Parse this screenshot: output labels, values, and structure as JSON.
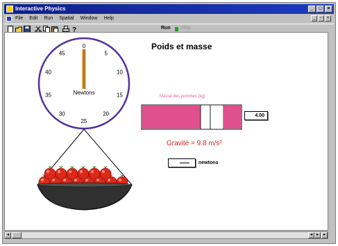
{
  "window": {
    "title": "Interactive Physics",
    "controls": {
      "minimize": "_",
      "maximize": "□",
      "close": "×"
    }
  },
  "menu": {
    "items": [
      "File",
      "Edit",
      "Run",
      "Spatial",
      "Window",
      "Help"
    ]
  },
  "mdi_controls": {
    "minimize": "_",
    "restore": "▫",
    "close": "×"
  },
  "toolbar": {
    "icons": [
      "new-icon",
      "open-icon",
      "save-icon",
      "cut-icon",
      "copy-icon",
      "paste-icon",
      "print-icon",
      "help-icon"
    ],
    "run_label": "Run",
    "stop_label": "Stop"
  },
  "scene": {
    "heading": "Poids et masse",
    "dial": {
      "ticks": [
        "0",
        "5",
        "10",
        "15",
        "20",
        "25",
        "30",
        "35",
        "40",
        "45"
      ],
      "center_label": "Newtons",
      "reading": 0
    },
    "mass_slider": {
      "caption": "Masse des pommes (kg)",
      "value": "4.00",
      "fill_fraction": 0.4
    },
    "gravity_text": "Gravité = 9.8 m/s²",
    "newton_output": {
      "value": "—",
      "unit": "newtons"
    },
    "apple_count": 14
  },
  "colors": {
    "titlebar": "#10208a",
    "slider": "#e0508c",
    "gravity": "#e02020",
    "dial_border": "#5030a0",
    "needle": "#d08820",
    "apple": "#e02818",
    "bowl": "#303030"
  }
}
